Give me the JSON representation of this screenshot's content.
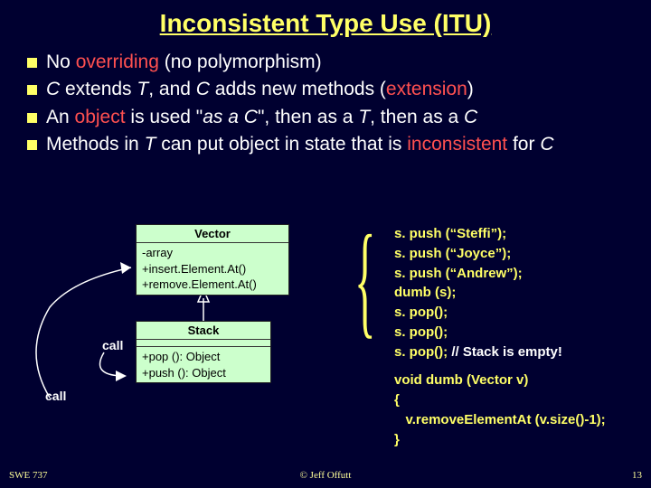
{
  "title": "Inconsistent Type Use (ITU)",
  "bullets": [
    {
      "pre": "No ",
      "red": "overriding",
      "post": " (no polymorphism)"
    },
    {
      "html": "<span class='ital'>C</span> extends <span class='ital'>T</span>, and <span class='ital'>C</span> adds new methods (<span class='red'>extension</span>)"
    },
    {
      "html": "An <span class='red'>object</span> is used \"<span class='ital'>as a C</span>\", then as a <span class='ital'>T</span>, then as a <span class='ital'>C</span>"
    },
    {
      "html": "Methods in <span class='ital'>T</span> can put object in state that is <span class='red'>inconsistent</span> for <span class='ital'>C</span>"
    }
  ],
  "uml": {
    "vector": {
      "name": "Vector",
      "attrs": "-array",
      "ops": [
        "+insert.Element.At()",
        "+remove.Element.At()"
      ]
    },
    "stack": {
      "name": "Stack",
      "ops": [
        "+pop (): Object",
        "+push (): Object"
      ]
    }
  },
  "calls": {
    "a": "call",
    "b": "call"
  },
  "code": {
    "l1": "s. push (“Steffi”);",
    "l2": "s. push (“Joyce”);",
    "l3": "s. push (“Andrew”);",
    "l4": "dumb (s);",
    "l5": "s. pop();",
    "l6": "s. pop();",
    "l7a": "s. pop();",
    "l7b": " // Stack is empty!",
    "fn1": "void dumb (Vector v)",
    "fn2": "{",
    "fn3": "   v.removeElementAt (v.size()-1);",
    "fn4": "}"
  },
  "footer": {
    "left": "SWE 737",
    "center": "© Jeff Offutt",
    "right": "13"
  }
}
